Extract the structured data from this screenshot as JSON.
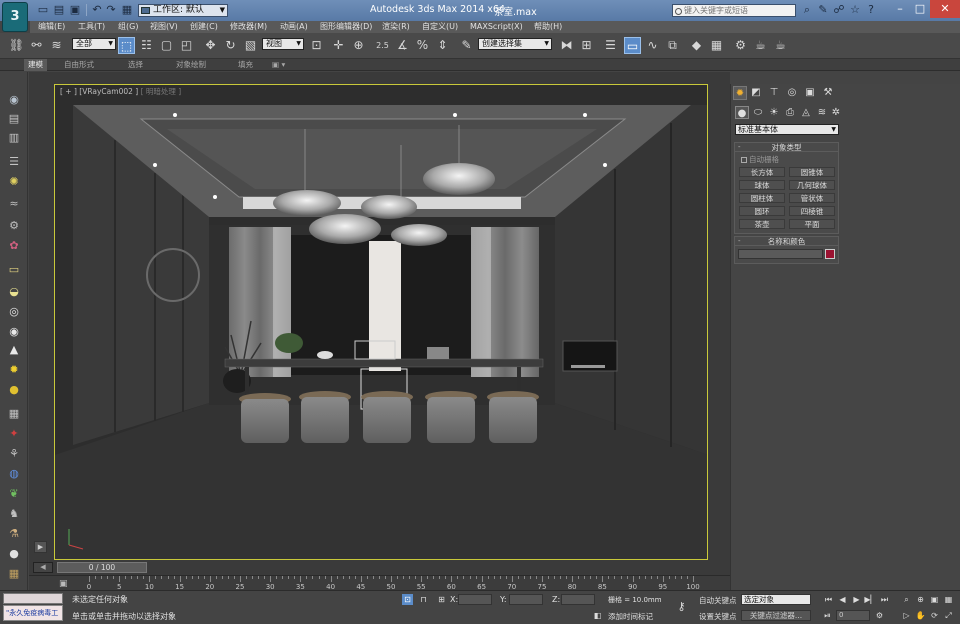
{
  "titlebar": {
    "logo": "3",
    "workspace_label": "工作区: 默认",
    "app_title": "Autodesk 3ds Max  2014 x64",
    "file_title": "茶室.max",
    "search_placeholder": "键入关键字或短语"
  },
  "menu": [
    "编辑(E)",
    "工具(T)",
    "组(G)",
    "视图(V)",
    "创建(C)",
    "修改器(M)",
    "动画(A)",
    "图形编辑器(D)",
    "渲染(R)",
    "自定义(U)",
    "MAXScript(X)",
    "帮助(H)"
  ],
  "toolbar": {
    "selection_filter": "全部",
    "reference_coord": "视图",
    "snap_value": "2.5",
    "named_selection": "创建选择集"
  },
  "ribbon": {
    "tabs": [
      "建模",
      "自由形式",
      "选择",
      "对象绘制",
      "填充"
    ],
    "active_index": 0
  },
  "viewport": {
    "label_plus": "[ + ]",
    "label_camera": "[VRayCam002 ]",
    "label_shading": "[ 明暗处理 ]"
  },
  "command_panel": {
    "category": "标准基本体",
    "object_type_title": "对象类型",
    "autogrid_label": "自动栅格",
    "buttons": [
      "长方体",
      "圆锥体",
      "球体",
      "几何球体",
      "圆柱体",
      "管状体",
      "圆环",
      "四棱锥",
      "茶壶",
      "平面"
    ],
    "name_color_title": "名称和颜色",
    "object_color": "#9b1231"
  },
  "timeline": {
    "frame_label": "0 / 100",
    "ticks": [
      "0",
      "5",
      "10",
      "15",
      "20",
      "25",
      "30",
      "35",
      "40",
      "45",
      "50",
      "55",
      "60",
      "65",
      "70",
      "75",
      "80",
      "85",
      "90",
      "95",
      "100"
    ]
  },
  "status": {
    "maxscript_text": "\"永久免疫病毒工",
    "line1": "未选定任何对象",
    "line2": "单击或单击并拖动以选择对象",
    "x_label": "X:",
    "y_label": "Y:",
    "z_label": "Z:",
    "grid_text": "栅格 = 10.0mm",
    "add_time_tag": "添加时间标记",
    "auto_key": "自动关键点",
    "selected_object": "选定对象",
    "set_key": "设置关键点",
    "key_filters": "关键点过滤器...",
    "frame_value": "0"
  }
}
